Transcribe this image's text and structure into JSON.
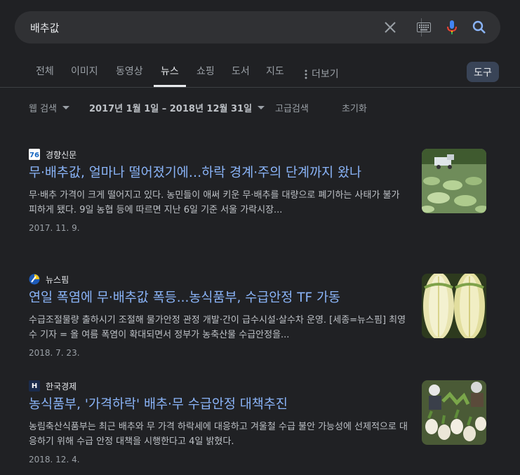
{
  "search": {
    "query": "배추값"
  },
  "tabs": [
    {
      "label": "전체"
    },
    {
      "label": "이미지"
    },
    {
      "label": "동영상"
    },
    {
      "label": "뉴스"
    },
    {
      "label": "쇼핑"
    },
    {
      "label": "도서"
    },
    {
      "label": "지도"
    },
    {
      "label": "더보기"
    }
  ],
  "tools": {
    "label": "도구"
  },
  "filters": {
    "web": "웹 검색",
    "daterange": "2017년 1월 1일 – 2018년 12월 31일",
    "advanced": "고급검색",
    "reset": "초기화"
  },
  "results": [
    {
      "source": "경향신문",
      "title": "무·배추값, 얼마나 떨어졌기에…하락 경계·주의 단계까지 왔나",
      "snippet": "무·배추 가격이 크게 떨어지고 있다. 농민들이 애써 키운 무·배추를 대량으로 폐기하는 사태가 불가피하게 됐다. 9일 농협 등에 따르면 지난 6일 기준 서울 가락시장...",
      "date": "2017. 11. 9."
    },
    {
      "source": "뉴스핌",
      "title": "연일 폭염에 무·배추값 폭등...농식품부, 수급안정 TF 가동",
      "snippet": "수급조절물량 출하시기 조절해 물가안정 관정 개발·간이 급수시설·살수차 운영. [세종=뉴스핌] 최영수 기자 = 올 여름 폭염이 확대되면서 정부가 농축산물 수급안정을...",
      "date": "2018. 7. 23."
    },
    {
      "source": "한국경제",
      "title": "농식품부, '가격하락' 배추·무 수급안정 대책추진",
      "snippet": "농림축산식품부는 최근 배추와 무 가격 하락세에 대응하고 겨울철 수급 불안 가능성에 선제적으로 대응하기 위해 수급 안정 대책을 시행한다고 4일 밝혔다.",
      "date": "2018. 12. 4."
    }
  ],
  "colors": {
    "link": "#8ab4f8",
    "background": "#202124",
    "searchbar": "#303134",
    "tools": "#394457"
  }
}
